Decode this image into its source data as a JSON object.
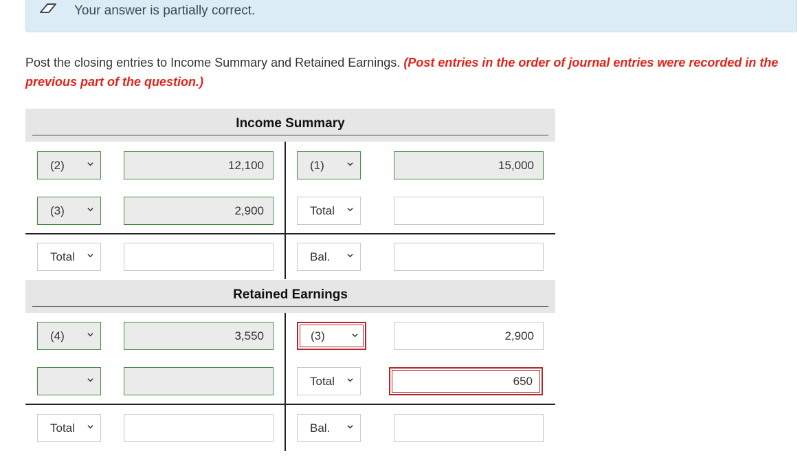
{
  "banner": {
    "message": "Your answer is partially correct.",
    "icon": "eraser-icon"
  },
  "instructions": {
    "text": "Post the closing entries to Income Summary and Retained Earnings.",
    "note": "(Post entries in the order of journal entries were recorded in the previous part of the question.)"
  },
  "income_summary": {
    "title": "Income Summary",
    "rows": [
      {
        "debit_ref": "(2)",
        "debit_amount": "12,100",
        "credit_ref": "(1)",
        "credit_amount": "15,000"
      },
      {
        "debit_ref": "(3)",
        "debit_amount": "2,900",
        "credit_ref": "Total",
        "credit_amount": ""
      },
      {
        "debit_ref": "Total",
        "debit_amount": "",
        "credit_ref": "Bal.",
        "credit_amount": ""
      }
    ]
  },
  "retained_earnings": {
    "title": "Retained Earnings",
    "rows": [
      {
        "debit_ref": "(4)",
        "debit_amount": "3,550",
        "credit_ref": "(3)",
        "credit_amount": "2,900"
      },
      {
        "debit_ref": "",
        "debit_amount": "",
        "credit_ref": "Total",
        "credit_amount": "650"
      },
      {
        "debit_ref": "Total",
        "debit_amount": "",
        "credit_ref": "Bal.",
        "credit_amount": ""
      }
    ]
  },
  "colors": {
    "error": "#b3262d",
    "correct": "#3f8f3f",
    "instruction_red": "#e2231a",
    "banner_bg": "#dcecf6"
  }
}
